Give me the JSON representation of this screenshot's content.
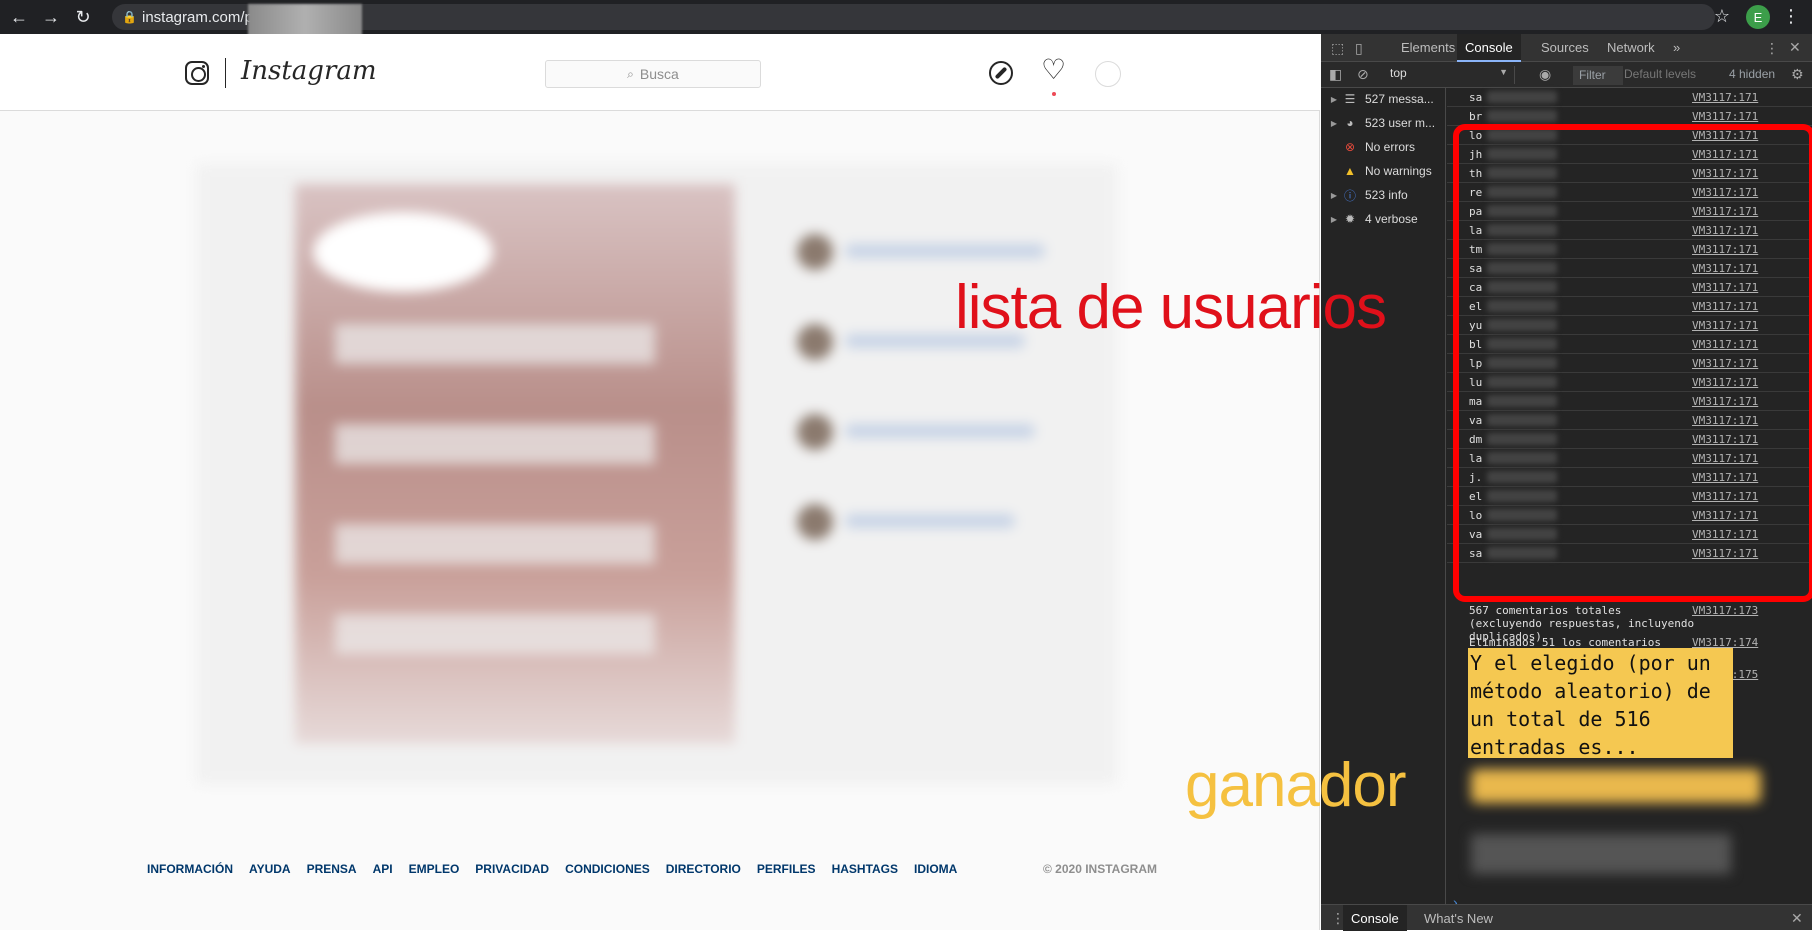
{
  "browser": {
    "url": "instagram.com/p/",
    "profile_initial": "E"
  },
  "instagram": {
    "wordmark": "Instagram",
    "search_placeholder": "Busca",
    "footer_links": [
      "INFORMACIÓN",
      "AYUDA",
      "PRENSA",
      "API",
      "EMPLEO",
      "PRIVACIDAD",
      "CONDICIONES",
      "DIRECTORIO",
      "PERFILES",
      "HASHTAGS",
      "IDIOMA"
    ],
    "copyright": "© 2020 INSTAGRAM"
  },
  "annotations": {
    "users_label": "lista de usuarios",
    "winner_label": "ganador",
    "accent_red": "#e0101a",
    "accent_yellow": "#f5c140"
  },
  "devtools": {
    "tabs": [
      "Elements",
      "Console",
      "Sources",
      "Network"
    ],
    "active_tab": "Console",
    "more_tabs": "»",
    "context": "top",
    "filter_placeholder": "Filter",
    "levels": "Default levels",
    "hidden": "4 hidden",
    "sidebar": [
      {
        "label": "527 messa...",
        "icon": "list-icon"
      },
      {
        "label": "523 user m...",
        "icon": "user-icon"
      },
      {
        "label": "No errors",
        "icon": "error-icon"
      },
      {
        "label": "No warnings",
        "icon": "warning-icon"
      },
      {
        "label": "523 info",
        "icon": "info-icon"
      },
      {
        "label": "4 verbose",
        "icon": "bug-icon"
      }
    ],
    "log_rows": [
      {
        "u": "sa",
        "src": "VM3117:171"
      },
      {
        "u": "br",
        "src": "VM3117:171"
      },
      {
        "u": "lo",
        "src": "VM3117:171"
      },
      {
        "u": "jh",
        "src": "VM3117:171"
      },
      {
        "u": "th",
        "src": "VM3117:171"
      },
      {
        "u": "re",
        "src": "VM3117:171"
      },
      {
        "u": "pa",
        "src": "VM3117:171"
      },
      {
        "u": "la",
        "src": "VM3117:171"
      },
      {
        "u": "tm",
        "src": "VM3117:171"
      },
      {
        "u": "sa",
        "src": "VM3117:171"
      },
      {
        "u": "ca",
        "src": "VM3117:171"
      },
      {
        "u": "el",
        "src": "VM3117:171"
      },
      {
        "u": "yu",
        "src": "VM3117:171"
      },
      {
        "u": "bl",
        "src": "VM3117:171"
      },
      {
        "u": "lp",
        "src": "VM3117:171"
      },
      {
        "u": "lu",
        "src": "VM3117:171"
      },
      {
        "u": "ma",
        "src": "VM3117:171"
      },
      {
        "u": "va",
        "src": "VM3117:171"
      },
      {
        "u": "dm",
        "src": "VM3117:171"
      },
      {
        "u": "la",
        "src": "VM3117:171"
      },
      {
        "u": "j.",
        "src": "VM3117:171"
      },
      {
        "u": "el",
        "src": "VM3117:171"
      },
      {
        "u": "lo",
        "src": "VM3117:171"
      },
      {
        "u": "va",
        "src": "VM3117:171"
      },
      {
        "u": "sa",
        "src": "VM3117:171"
      }
    ],
    "msg_total": "567 comentarios totales (excluyendo respuestas, incluyendo duplicados)",
    "msg_total_src": "VM3117:173",
    "msg_dupes": "Eliminados 51 los comentarios duplicados",
    "msg_dupes_src": "VM3117:174",
    "msg_winner_src": "VM3117:175",
    "winner_text": "Y el elegido (por un método aleatorio) de un total de 516 entradas es...",
    "prompt": "›",
    "drawer_tabs": [
      "Console",
      "What's New"
    ]
  }
}
